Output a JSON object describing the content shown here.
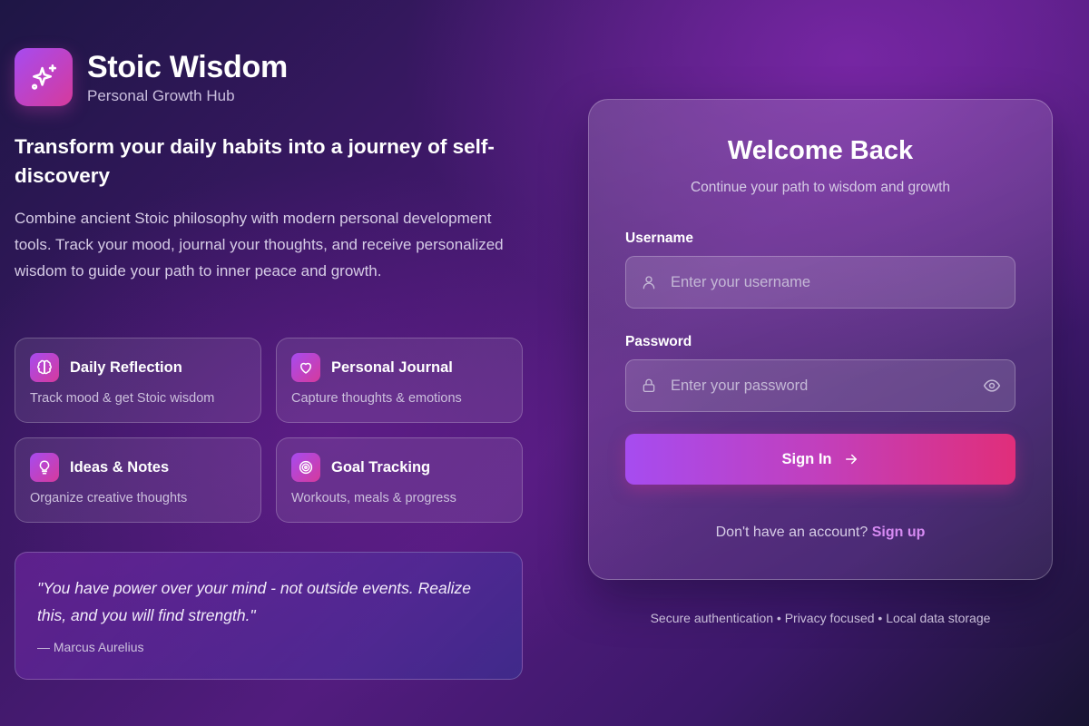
{
  "brand": {
    "title": "Stoic Wisdom",
    "subtitle": "Personal Growth Hub",
    "logo_icon": "sparkles-icon"
  },
  "hero": {
    "headline": "Transform your daily habits into a journey of self-discovery",
    "intro": "Combine ancient Stoic philosophy with modern personal development tools. Track your mood, journal your thoughts, and receive personalized wisdom to guide your path to inner peace and growth."
  },
  "features": [
    {
      "title": "Daily Reflection",
      "description": "Track mood & get Stoic wisdom",
      "icon": "brain-icon"
    },
    {
      "title": "Personal Journal",
      "description": "Capture thoughts & emotions",
      "icon": "heart-icon"
    },
    {
      "title": "Ideas & Notes",
      "description": "Organize creative thoughts",
      "icon": "lightbulb-icon"
    },
    {
      "title": "Goal Tracking",
      "description": "Workouts, meals & progress",
      "icon": "target-icon"
    }
  ],
  "quote": {
    "text": "\"You have power over your mind - not outside events. Realize this, and you will find strength.\"",
    "author": "— Marcus Aurelius"
  },
  "login": {
    "title": "Welcome Back",
    "subtitle": "Continue your path to wisdom and growth",
    "username_label": "Username",
    "username_placeholder": "Enter your username",
    "username_value": "",
    "password_label": "Password",
    "password_placeholder": "Enter your password",
    "password_value": "",
    "signin_label": "Sign In",
    "signup_prompt": "Don't have an account?",
    "signup_link": "Sign up"
  },
  "footer": {
    "note": "Secure authentication • Privacy focused • Local data storage"
  },
  "colors": {
    "accent_start": "#a64cf0",
    "accent_end": "#e02e7a",
    "link": "#d68af2"
  }
}
